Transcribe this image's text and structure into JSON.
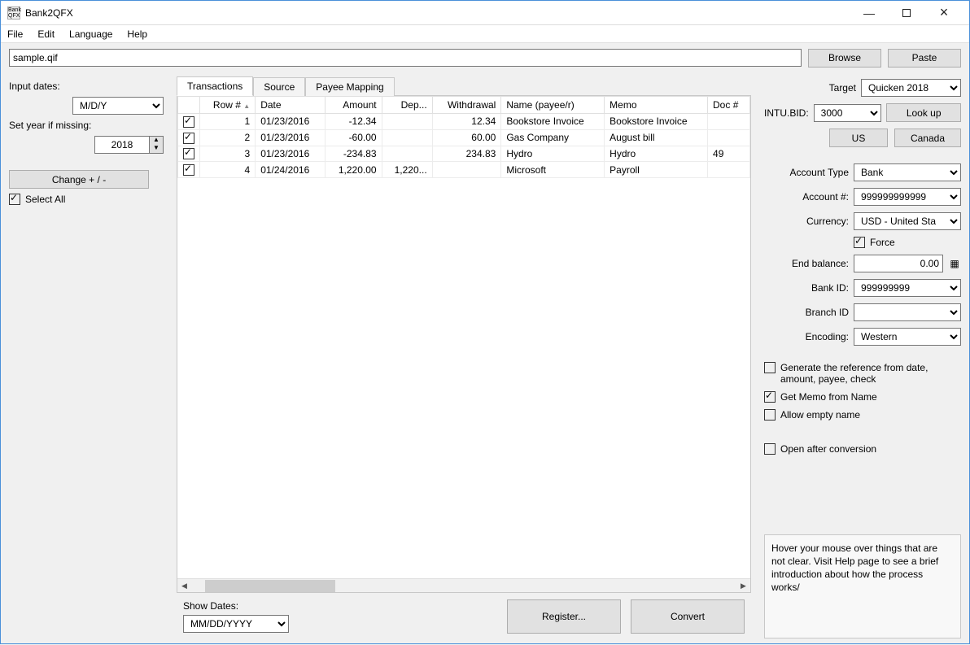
{
  "title": "Bank2QFX",
  "menu": {
    "file": "File",
    "edit": "Edit",
    "language": "Language",
    "help": "Help"
  },
  "filepath": "sample.qif",
  "browse": "Browse",
  "paste": "Paste",
  "left": {
    "input_dates": "Input dates:",
    "date_format": "M/D/Y",
    "set_year": "Set year if missing:",
    "year": "2018",
    "change": "Change + / -",
    "select_all": "Select All"
  },
  "tabs": {
    "transactions": "Transactions",
    "source": "Source",
    "payee_mapping": "Payee Mapping"
  },
  "cols": {
    "row": "Row #",
    "date": "Date",
    "amount": "Amount",
    "deposit": "Dep...",
    "withdrawal": "Withdrawal",
    "name": "Name (payee/r)",
    "memo": "Memo",
    "doc": "Doc #"
  },
  "rows": [
    {
      "n": "1",
      "date": "01/23/2016",
      "amount": "-12.34",
      "deposit": "",
      "withdrawal": "12.34",
      "name": "Bookstore Invoice",
      "memo": "Bookstore Invoice",
      "doc": ""
    },
    {
      "n": "2",
      "date": "01/23/2016",
      "amount": "-60.00",
      "deposit": "",
      "withdrawal": "60.00",
      "name": "Gas Company",
      "memo": "August bill",
      "doc": ""
    },
    {
      "n": "3",
      "date": "01/23/2016",
      "amount": "-234.83",
      "deposit": "",
      "withdrawal": "234.83",
      "name": "Hydro",
      "memo": "Hydro",
      "doc": "49"
    },
    {
      "n": "4",
      "date": "01/24/2016",
      "amount": "1,220.00",
      "deposit": "1,220...",
      "withdrawal": "",
      "name": "Microsoft",
      "memo": "Payroll",
      "doc": ""
    }
  ],
  "show_dates": "Show Dates:",
  "show_dates_fmt": "MM/DD/YYYY",
  "register": "Register...",
  "convert": "Convert",
  "right": {
    "target": "Target",
    "target_val": "Quicken 2018",
    "intu": "INTU.BID:",
    "intu_val": "3000",
    "lookup": "Look up",
    "us": "US",
    "canada": "Canada",
    "account_type": "Account Type",
    "account_type_val": "Bank",
    "account_num": "Account #:",
    "account_num_val": "999999999999",
    "currency": "Currency:",
    "currency_val": "USD - United Sta",
    "force": "Force",
    "end_balance": "End balance:",
    "end_balance_val": "0.00",
    "bank_id": "Bank ID:",
    "bank_id_val": "999999999",
    "branch_id": "Branch ID",
    "branch_id_val": "",
    "encoding": "Encoding:",
    "encoding_val": "Western",
    "gen_ref": "Generate the reference from date, amount, payee, check",
    "get_memo": "Get Memo from Name",
    "allow_empty": "Allow empty name",
    "open_after": "Open after conversion",
    "help": "Hover your mouse over things that are not clear. Visit Help page to see a brief introduction about how the process works/"
  }
}
